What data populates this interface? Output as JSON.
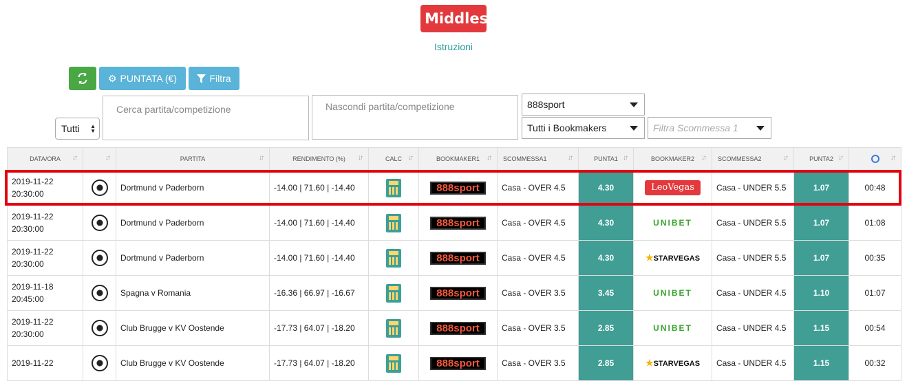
{
  "header": {
    "title": "Middles",
    "instructions": "Istruzioni"
  },
  "toolbar": {
    "puntata_label": "PUNTATA (€)",
    "filtra_label": "Filtra"
  },
  "filters": {
    "tipo": "Tutti",
    "search_placeholder": "Cerca partita/competizione",
    "hide_placeholder": "Nascondi partita/competizione",
    "bookmaker1": "888sport",
    "bookmaker2": "Tutti i Bookmakers",
    "scommessa_placeholder": "Filtra Scommessa 1"
  },
  "columns": [
    "DATA/ORA",
    "",
    "PARTITA",
    "RENDIMENTO (%)",
    "CALC",
    "BOOKMAKER1",
    "SCOMMESSA1",
    "PUNTA1",
    "BOOKMAKER2",
    "SCOMMESSA2",
    "PUNTA2",
    ""
  ],
  "rows": [
    {
      "date": "2019-11-22",
      "time": "20:30:00",
      "match": "Dortmund v Paderborn",
      "yield": "-14.00 | 71.60 | -14.40",
      "bm1": "888sport",
      "bet1": "Casa - OVER 4.5",
      "odd1": "4.30",
      "bm2": "LeoVegas",
      "bet2": "Casa - UNDER 5.5",
      "odd2": "1.07",
      "age": "00:48"
    },
    {
      "date": "2019-11-22",
      "time": "20:30:00",
      "match": "Dortmund v Paderborn",
      "yield": "-14.00 | 71.60 | -14.40",
      "bm1": "888sport",
      "bet1": "Casa - OVER 4.5",
      "odd1": "4.30",
      "bm2": "UNIBET",
      "bet2": "Casa - UNDER 5.5",
      "odd2": "1.07",
      "age": "01:08"
    },
    {
      "date": "2019-11-22",
      "time": "20:30:00",
      "match": "Dortmund v Paderborn",
      "yield": "-14.00 | 71.60 | -14.40",
      "bm1": "888sport",
      "bet1": "Casa - OVER 4.5",
      "odd1": "4.30",
      "bm2": "STARVEGAS",
      "bet2": "Casa - UNDER 5.5",
      "odd2": "1.07",
      "age": "00:35"
    },
    {
      "date": "2019-11-18",
      "time": "20:45:00",
      "match": "Spagna v Romania",
      "yield": "-16.36 | 66.97 | -16.67",
      "bm1": "888sport",
      "bet1": "Casa - OVER 3.5",
      "odd1": "3.45",
      "bm2": "UNIBET",
      "bet2": "Casa - UNDER 4.5",
      "odd2": "1.10",
      "age": "01:07"
    },
    {
      "date": "2019-11-22",
      "time": "20:30:00",
      "match": "Club Brugge v KV Oostende",
      "yield": "-17.73 | 64.07 | -18.20",
      "bm1": "888sport",
      "bet1": "Casa - OVER 3.5",
      "odd1": "2.85",
      "bm2": "UNIBET",
      "bet2": "Casa - UNDER 4.5",
      "odd2": "1.15",
      "age": "00:54"
    },
    {
      "date": "2019-11-22",
      "time": "",
      "match": "Club Brugge v KV Oostende",
      "yield": "-17.73 | 64.07 | -18.20",
      "bm1": "888sport",
      "bet1": "Casa - OVER 3.5",
      "odd1": "2.85",
      "bm2": "STARVEGAS",
      "bet2": "Casa - UNDER 4.5",
      "odd2": "1.15",
      "age": "00:32"
    }
  ],
  "colors": {
    "accent_red": "#e3393c",
    "teal": "#409e95",
    "green": "#49a844",
    "blue": "#5ab3d8"
  }
}
